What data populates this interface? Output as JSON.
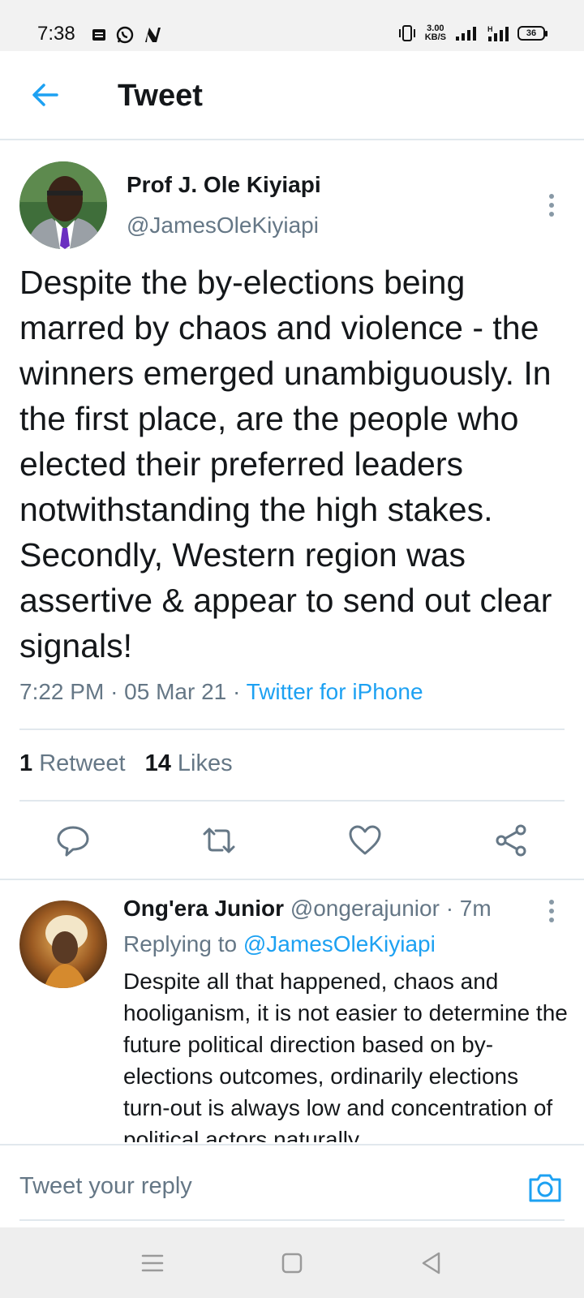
{
  "status_bar": {
    "time": "7:38",
    "speed_value": "3.00",
    "speed_unit": "KB/S",
    "battery": "36",
    "left_icons": [
      "notification-icon",
      "whatsapp-icon",
      "n-app-icon"
    ],
    "right_icons": [
      "vibrate-icon",
      "signal-icon",
      "signal-h-icon",
      "battery-icon"
    ]
  },
  "header": {
    "title": "Tweet",
    "back_icon": "back-arrow-icon"
  },
  "tweet": {
    "author_name": "Prof J. Ole Kiyiapi",
    "author_handle": "@JamesOleKiyiapi",
    "text": "Despite the by-elections being marred by chaos and violence - the winners emerged unambiguously. In the first place, are the people who elected their preferred leaders notwithstanding the high stakes. Secondly, Western region was assertive & appear to send out clear signals!",
    "time": "7:22 PM",
    "date": "05 Mar 21",
    "separator": "·",
    "source": "Twitter for iPhone",
    "retweet_count": "1",
    "retweet_label": "Retweet",
    "like_count": "14",
    "like_label": "Likes",
    "actions": [
      "reply-icon",
      "retweet-icon",
      "like-icon",
      "share-icon"
    ]
  },
  "reply": {
    "author_name": "Ong'era Junior",
    "author_handle": "@ongerajunior",
    "time": "7m",
    "replying_prefix": "Replying to",
    "replying_handle": "@JamesOleKiyiapi",
    "text": "Despite all that happened, chaos and hooliganism, it is not easier to determine the future political direction based on by-elections outcomes, ordinarily elections turn-out is always low and concentration of political actors naturally"
  },
  "compose": {
    "placeholder": "Tweet your reply",
    "camera_icon": "camera-icon"
  },
  "nav_bar": {
    "buttons": [
      "menu-icon",
      "home-square-icon",
      "back-triangle-icon"
    ]
  },
  "colors": {
    "accent": "#1da1f2",
    "secondary_text": "#657786",
    "primary_text": "#14171a",
    "divider": "#e1e8ed"
  }
}
